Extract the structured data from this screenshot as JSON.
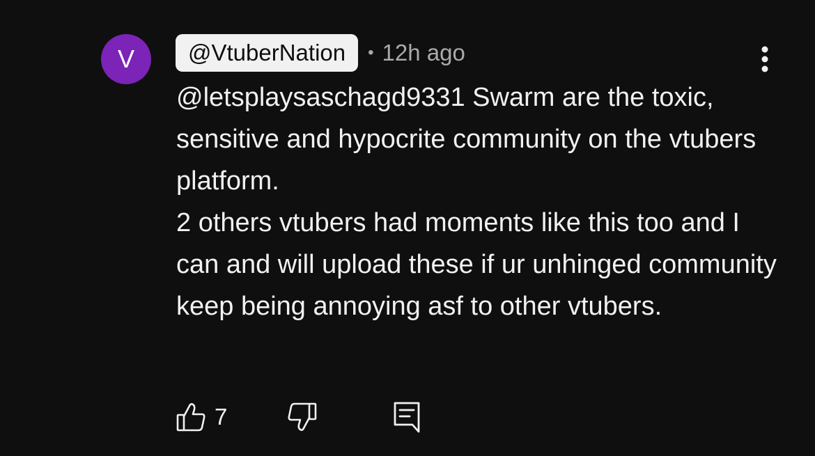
{
  "comment": {
    "avatar_letter": "V",
    "avatar_color": "#7c23b8",
    "author_handle": "@VtuberNation",
    "separator": "•",
    "timestamp": "12h ago",
    "more_icon": "more-vertical-icon",
    "body_lines": [
      "@letsplaysaschagd9331 Swarm are the toxic, sensitive and hypocrite community on the vtubers platform.",
      "2 others vtubers had moments like this too and I can and will upload these if ur unhinged community keep being annoying asf to other vtubers."
    ],
    "like_icon": "thumbs-up-icon",
    "like_count": "7",
    "dislike_icon": "thumbs-down-icon",
    "reply_icon": "reply-comment-icon"
  }
}
